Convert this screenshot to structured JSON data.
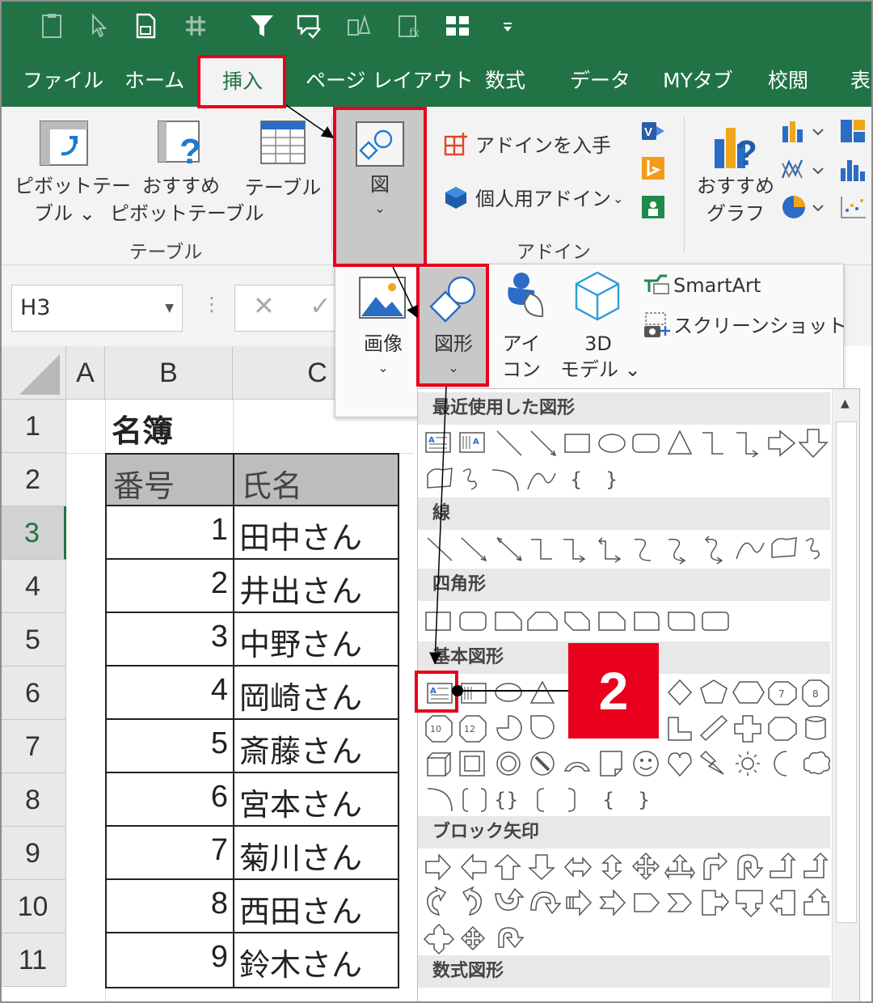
{
  "tabs": [
    "ファイル",
    "ホーム",
    "挿入",
    "ページ レイアウト",
    "数式",
    "データ",
    "MYタブ",
    "校閲",
    "表"
  ],
  "active_tab": "挿入",
  "ribbon": {
    "pivot": [
      "ピボットテー",
      "ブル ⌄"
    ],
    "recommended_pivot": [
      "おすすめ",
      "ピボットテーブル"
    ],
    "table": "テーブル",
    "group_table": "テーブル",
    "illustrations": "図",
    "get_addins": "アドインを入手",
    "personal_addins": "個人用アドイン",
    "group_addins": "アドイン",
    "recommended_charts": [
      "おすすめ",
      "グラフ"
    ]
  },
  "formula_bar": {
    "name_box": "H3"
  },
  "illustrations_menu": {
    "picture": "画像",
    "shapes": "図形",
    "icons": [
      "アイ",
      "コン"
    ],
    "models_3d": [
      "3D",
      "モデル ⌄"
    ],
    "smartart": "SmartArt",
    "screenshot": "スクリーンショット"
  },
  "shapes_gallery": {
    "sections": [
      "最近使用した図形",
      "線",
      "四角形",
      "基本図形",
      "ブロック矢印",
      "数式図形"
    ]
  },
  "sheet": {
    "columns": [
      "A",
      "B",
      "C"
    ],
    "rows": [
      "1",
      "2",
      "3",
      "4",
      "5",
      "6",
      "7",
      "8",
      "9",
      "10",
      "11"
    ],
    "title": "名簿",
    "headers": [
      "番号",
      "氏名"
    ],
    "records": [
      {
        "no": "1",
        "name": "田中さん"
      },
      {
        "no": "2",
        "name": "井出さん"
      },
      {
        "no": "3",
        "name": "中野さん"
      },
      {
        "no": "4",
        "name": "岡崎さん"
      },
      {
        "no": "5",
        "name": "斎藤さん"
      },
      {
        "no": "6",
        "name": "宮本さん"
      },
      {
        "no": "7",
        "name": "菊川さん"
      },
      {
        "no": "8",
        "name": "西田さん"
      },
      {
        "no": "9",
        "name": "鈴木さん"
      }
    ]
  },
  "step_badge": "2",
  "colors": {
    "excel_green": "#217346",
    "highlight_red": "#e8001c"
  }
}
